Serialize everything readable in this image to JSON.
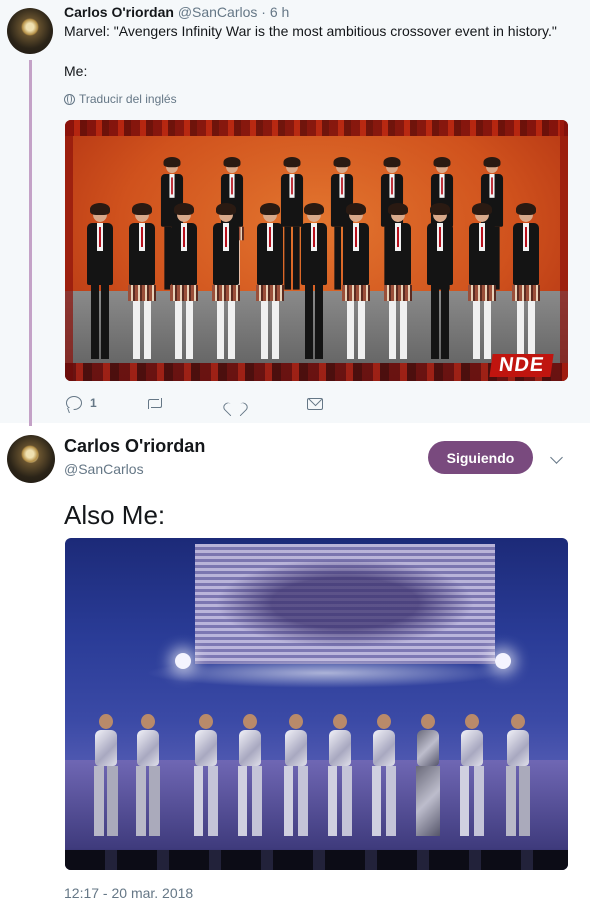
{
  "reply_tweet": {
    "author_name": "Carlos O'riordan",
    "author_handle": "@SanCarlos",
    "separator": "·",
    "time": "6 h",
    "text_line1": "Marvel: \"Avengers Infinity War is the most ambitious crossover event in history.\"",
    "text_line2": "Me:",
    "translate_label": "Traducir del inglés",
    "image_overlay_text": "NDE",
    "actions": {
      "reply_count": "1",
      "retweet_count": "",
      "like_count": ""
    }
  },
  "main_tweet": {
    "author_name": "Carlos O'riordan",
    "author_handle": "@SanCarlos",
    "follow_button_label": "Siguiendo",
    "text": "Also Me:",
    "timestamp": "12:17 - 20 mar. 2018"
  },
  "colors": {
    "follow_button": "#794a7e",
    "thread_line": "#c4a2c7",
    "secondary_text": "#657786",
    "reply_background": "#f5f8fa"
  },
  "icons": [
    "globe-icon",
    "reply-icon",
    "retweet-icon",
    "heart-icon",
    "mail-icon",
    "chevron-down-icon"
  ]
}
